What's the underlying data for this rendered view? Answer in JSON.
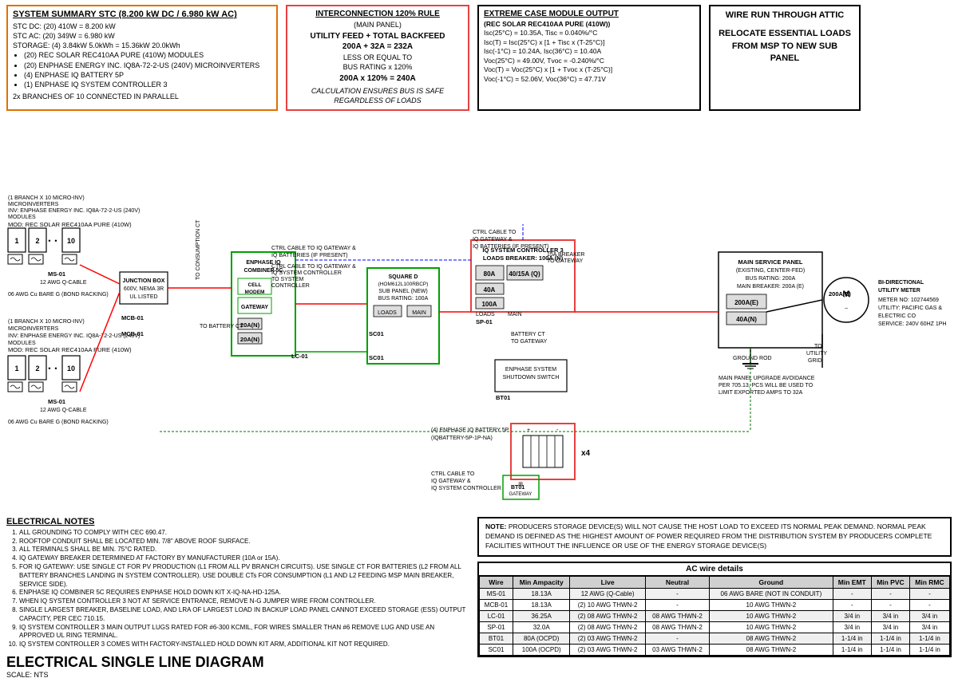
{
  "system_summary": {
    "title": "SYSTEM SUMMARY STC (8.200 kW DC / 6.980 kW AC)",
    "lines": [
      "STC DC: (20) 410W = 8.200 kW",
      "STC AC: (20) 349W = 6.980 kW",
      "STORAGE: (4) 3.84kW 5.0kWh = 15.36kW 20.0kWh",
      "(20) REC SOLAR REC410AA PURE (410W) MODULES",
      "(20) ENPHASE ENERGY INC. IQ8A-72-2-US (240V) MICROINVERTERS",
      "(4) ENPHASE IQ BATTERY 5P",
      "(1) ENPHASE IQ SYSTEM CONTROLLER 3",
      "2x BRANCHES OF 10 CONNECTED IN PARALLEL"
    ]
  },
  "interconnection": {
    "title": "INTERCONNECTION 120% RULE",
    "subtitle": "(MAIN PANEL)",
    "body": [
      "UTILITY FEED + TOTAL BACKFEED",
      "200A + 32A = 232A",
      "LESS OR EQUAL TO",
      "BUS RATING x 120%",
      "200A x 120% = 240A"
    ],
    "footer": "CALCULATION ENSURES BUS IS SAFE REGARDLESS OF LOADS"
  },
  "extreme_case": {
    "title": "EXTREME CASE MODULE OUTPUT",
    "subtitle": "(REC SOLAR REC410AA PURE (410W))",
    "lines": [
      "Isc(25°C) = 10.35A, Tisc = 0.040%/°C",
      "Isc(T) = Isc(25°C) x [1 + Tisc x (T-25°C)]",
      "Isc(-1°C) = 10.24A, Isc(36°C) = 10.40A",
      "Voc(25°C) = 49.00V, Tvoc = -0.240%/°C",
      "Voc(T) = Voc(25°C) x [1 + Tvoc x (T-25°C)]",
      "Voc(-1°C) = 52.06V, Voc(36°C) = 47.71V"
    ]
  },
  "wire_run": {
    "line1": "WIRE RUN THROUGH ATTIC",
    "line2": "RELOCATE ESSENTIAL LOADS FROM MSP TO NEW SUB PANEL"
  },
  "electrical_notes": {
    "title": "ELECTRICAL NOTES",
    "items": [
      "ALL GROUNDING TO COMPLY WITH CEC 690.47.",
      "ROOFTOP CONDUIT SHALL BE LOCATED MIN. 7/8\" ABOVE ROOF SURFACE.",
      "ALL TERMINALS SHALL BE MIN. 75°C RATED.",
      "IQ GATEWAY BREAKER DETERMINED AT FACTORY BY MANUFACTURER (10A or 15A).",
      "FOR IQ GATEWAY: USE SINGLE CT FOR PV PRODUCTION (L1 FROM ALL PV BRANCH CIRCUITS). USE SINGLE CT FOR BATTERIES (L2 FROM ALL BATTERY BRANCHES LANDING IN SYSTEM CONTROLLER). USE DOUBLE CTs FOR CONSUMPTION (L1 AND L2 FEEDING MSP MAIN BREAKER, SERVICE SIDE).",
      "ENPHASE IQ COMBINER 5C REQUIRES ENPHASE HOLD DOWN KIT X-IQ-NA-HD-125A.",
      "WHEN IQ SYSTEM CONTROLLER 3 NOT AT SERVICE ENTRANCE, REMOVE N-G JUMPER WIRE FROM CONTROLLER.",
      "SINGLE LARGEST BREAKER, BASELINE LOAD, AND LRA OF LARGEST LOAD IN BACKUP LOAD PANEL CANNOT EXCEED STORAGE (ESS) OUTPUT CAPACITY, PER CEC 710.15.",
      "IQ SYSTEM CONTROLLER 3 MAIN OUTPUT LUGS RATED FOR #6-300 KCMIL, FOR WIRES SMALLER THAN #6 REMOVE LUG AND USE AN APPROVED UL RING TERMINAL.",
      "IQ SYSTEM CONTROLLER 3 COMES WITH FACTORY-INSTALLED HOLD DOWN KIT ARM, ADDITIONAL KIT NOT REQUIRED."
    ],
    "big_title": "ELECTRICAL SINGLE LINE DIAGRAM",
    "scale": "SCALE: NTS"
  },
  "storage_note": {
    "title": "NOTE:",
    "body": "PRODUCERS STORAGE DEVICE(S) WILL NOT CAUSE THE HOST LOAD TO EXCEED ITS NORMAL PEAK DEMAND. NORMAL PEAK DEMAND IS DEFINED AS THE HIGHEST AMOUNT OF POWER REQUIRED FROM THE DISTRIBUTION SYSTEM BY PRODUCERS COMPLETE FACILITIES WITHOUT THE INFLUENCE OR USE OF THE ENERGY STORAGE DEVICE(S)"
  },
  "ac_wire_table": {
    "title": "AC wire details",
    "headers": [
      "Wire",
      "Min Ampacity",
      "Live",
      "Neutral",
      "Ground",
      "Min EMT",
      "Min PVC",
      "Min RMC"
    ],
    "rows": [
      [
        "MS-01",
        "18.13A",
        "12 AWG (Q-Cable)",
        "-",
        "06 AWG BARE (NOT IN CONDUIT)",
        "-",
        "-",
        "-"
      ],
      [
        "MCB-01",
        "18.13A",
        "(2) 10 AWG THWN-2",
        "-",
        "10 AWG THWN-2",
        "-",
        "-",
        "-"
      ],
      [
        "LC-01",
        "36.25A",
        "(2) 08 AWG THWN-2",
        "08 AWG THWN-2",
        "10 AWG THWN-2",
        "3/4 in",
        "3/4 in",
        "3/4 in"
      ],
      [
        "SP-01",
        "32.0A",
        "(2) 08 AWG THWN-2",
        "08 AWG THWN-2",
        "10 AWG THWN-2",
        "3/4 in",
        "3/4 in",
        "3/4 in"
      ],
      [
        "BT01",
        "80A (OCPD)",
        "(2) 03 AWG THWN-2",
        "-",
        "08 AWG THWN-2",
        "1-1/4 in",
        "1-1/4 in",
        "1-1/4 in"
      ],
      [
        "SC01",
        "100A (OCPD)",
        "(2) 03 AWG THWN-2",
        "03 AWG THWN-2",
        "08 AWG THWN-2",
        "1-1/4 in",
        "1-1/4 in",
        "1-1/4 in"
      ]
    ]
  },
  "diagram_labels": {
    "modules_top": "MOD: REC SOLAR REC410AA PURE (410W) MODULES",
    "inv_top": "INV: ENPHASE ENERGY INC. IQ8A-72-2-US (240V) MICROINVERTERS",
    "branch_top": "(1 BRANCH X 10 MICRO-INV)",
    "modules_bot": "MOD: REC SOLAR REC410AA PURE (410W) MODULES",
    "inv_bot": "INV: ENPHASE ENERGY INC. IQ8A-72-2-US (240V) MICROINVERTERS",
    "branch_bot": "(1 BRANCH X 10 MICRO-INV)",
    "junction_box": "JUNCTION BOX\n600V, NEMA 3R\nUL LISTED",
    "ms01": "MS-01",
    "bond_racking_top": "06 AWG Cu BARE G (BOND RACKING)",
    "bond_racking_bot": "06 AWG Cu BARE G (BOND RACKING)",
    "cable_top": "12 AWG Q-CABLE",
    "cable_bot": "12 AWG Q-CABLE",
    "combiner": "ENPHASE IQ COMBINER 5C",
    "cell_modem": "CELL MODEM",
    "gateway": "GATEWAY",
    "ctrl_cable_1": "CTRL CABLE TO IQ GATEWAY & IQ BATTERIES (IF PRESENT)",
    "ctrl_cable_2": "CTRL CABLE TO IQ GATEWAY & IQ SYSTEM CONTROLLER",
    "to_battery_ct": "TO BATTERY CT",
    "to_consumption": "TO CONSUMPTION CT",
    "lc01_label": "LC-01",
    "20a_n_top": "20A(N)",
    "20a_n_bot": "20A(N)",
    "mcb01_top": "MCB-01",
    "mcb01_bot": "MCB-01",
    "square_d": "SQUARE D\n(HOM612L100RBCP)\nSUB PANEL (NEW)\nBUS RATING: 100A",
    "loads_breaker": "IQ SYSTEM CONTROLLER 3\nLOADS BREAKER: 100A (N)",
    "80a": "80A",
    "40_15a": "40/15A (Q)",
    "40a": "40A",
    "100a_loads": "100A",
    "loads_label": "LOADS",
    "main_label": "MAIN",
    "sp01": "SP-01",
    "battery_ct": "BATTERY CT TO GATEWAY",
    "15a_breaker": "15A BREAKER TO GATEWAY",
    "sc01": "SC01",
    "enphase_shutdown": "ENPHASE SYSTEM SHUTDOWN SWITCH",
    "bt01": "BT01",
    "batteries": "(4) ENPHASE IQ BATTERY 5P\n(IQBATTERY-5P-1P-NA)",
    "x4": "x4",
    "ctrl_to_system": "CTRL CABLE TO IQ GATEWAY & IQ SYSTEM CONTROLLER",
    "main_service_panel": "MAIN SERVICE PANEL\n(EXISTING, CENTER-FED)\nBUS RATING: 200A\nMAIN BREAKER: 200A (E)",
    "meter_no": "METER NO: 102744569",
    "utility": "UTILITY: PACIFIC GAS &\nELECTRIC CO",
    "service": "SERVICE: 240V 60HZ 1PH",
    "bi_directional": "BI-DIRECTIONAL\nUTILITY METER",
    "200a_e": "200A(E)",
    "40a_n": "40A(N)",
    "utility_grid": "TO UTILITY GRID",
    "ground_rod": "GROUND ROD",
    "main_panel_upgrade": "MAIN PANEL UPGRADE AVOIDANCE\nPER 705.13, PCS WILL BE USED TO\nLIMIT EXPORTED AMPS TO 32A"
  }
}
